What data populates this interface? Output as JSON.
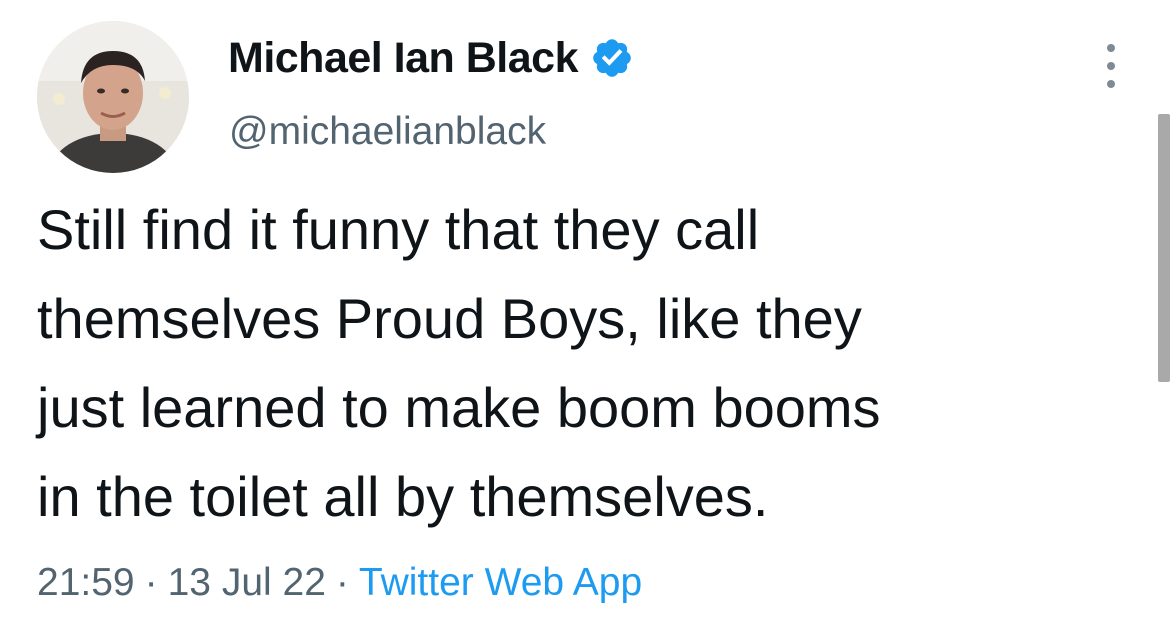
{
  "author": {
    "name": "Michael Ian Black",
    "handle": "@michaelianblack",
    "verified": true,
    "verified_color": "#1d9bf0"
  },
  "tweet": {
    "lines": [
      "Still find it funny that they call",
      "themselves Proud Boys, like they",
      "just learned to make boom booms",
      "in the toilet all by themselves."
    ]
  },
  "meta": {
    "time": "21:59",
    "separator": "·",
    "date": "13 Jul 22",
    "source": "Twitter Web App",
    "source_color": "#1d9bf0"
  },
  "icons": {
    "avatar": "avatar-photo",
    "verified": "verified-badge-icon",
    "more": "more-options-icon"
  }
}
